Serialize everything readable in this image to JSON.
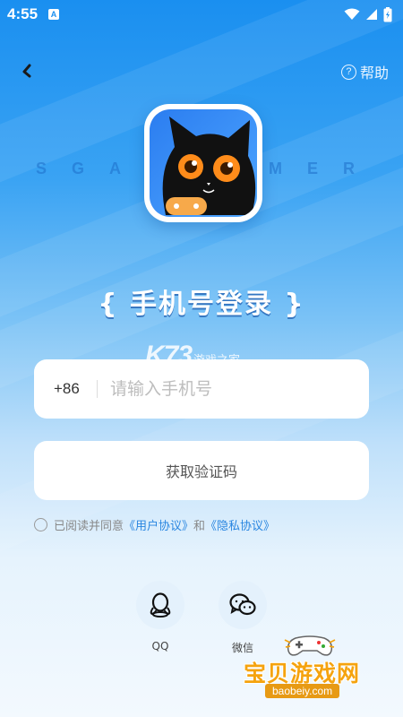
{
  "status_bar": {
    "time": "4:55",
    "notification_icon_letter": "A",
    "icons": [
      "wifi-icon",
      "signal-icon",
      "battery-icon"
    ]
  },
  "header": {
    "back_icon": "back-arrow-icon",
    "help_label": "帮助",
    "help_icon_glyph": "?"
  },
  "brand": {
    "left_text": "SGA",
    "right_text": "MER"
  },
  "page_title": "{ 手机号登录 }",
  "watermark": {
    "logo_text": "K73",
    "caption": "游戏之家"
  },
  "phone_field": {
    "country_code": "+86",
    "placeholder": "请输入手机号",
    "value": ""
  },
  "get_code_button": "获取验证码",
  "agreement": {
    "prefix": "已阅读并同意",
    "user_agreement": "《用户协议》",
    "conjunction": "和",
    "privacy_policy": "《隐私协议》",
    "checked": false
  },
  "social_login": [
    {
      "label": "QQ",
      "icon": "qq-icon"
    },
    {
      "label": "微信",
      "icon": "wechat-icon"
    }
  ],
  "site_watermark": {
    "title": "宝贝游戏网",
    "url": "baobeiy.com"
  },
  "colors": {
    "gradient_top": "#1a8ff0",
    "gradient_bottom": "#f3f9fe",
    "link": "#2a86e0",
    "watermark_orange": "#f5a30e"
  }
}
